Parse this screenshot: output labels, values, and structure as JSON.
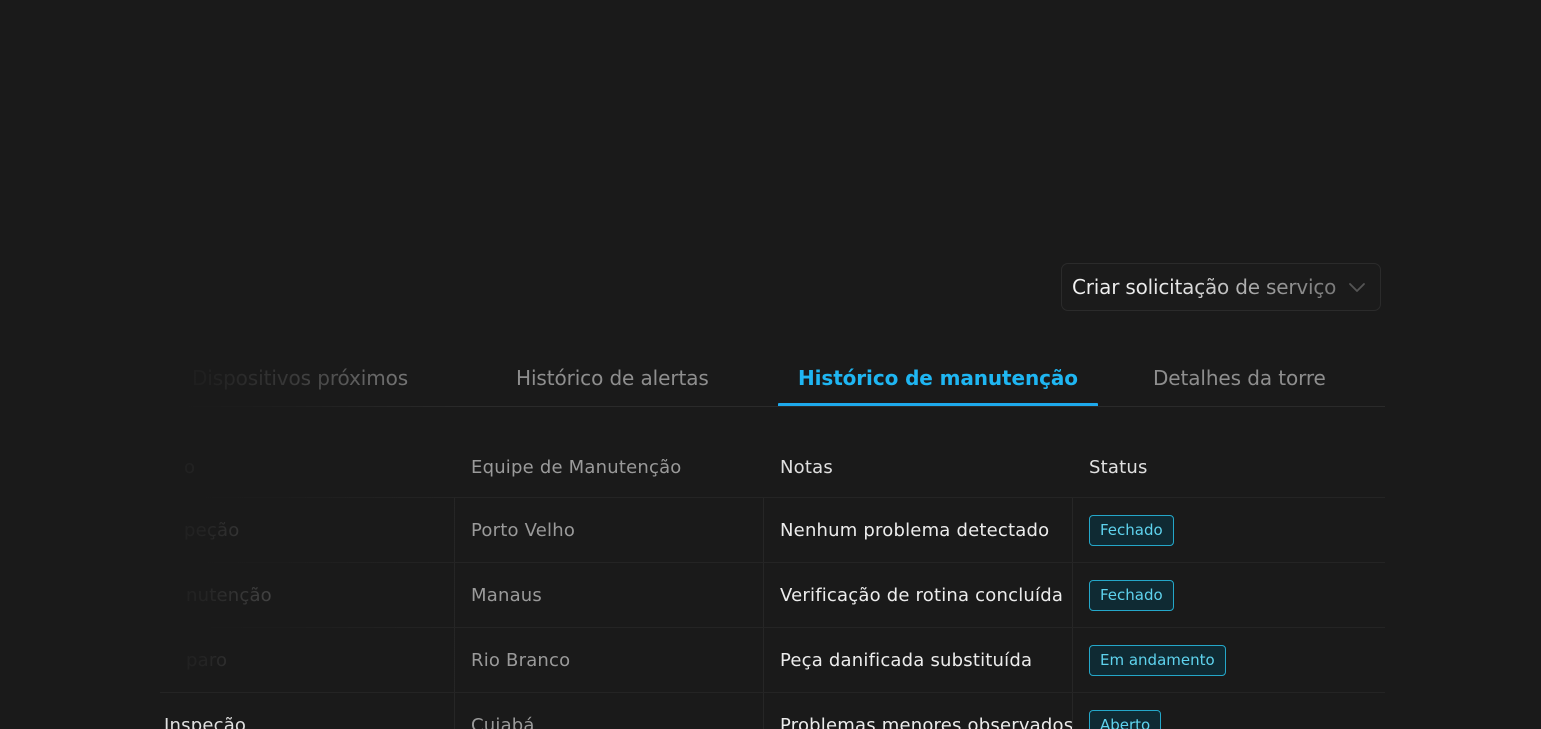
{
  "service_request": {
    "label": "Criar solicitação de serviço",
    "icon": "chevron-down-icon"
  },
  "tabs": [
    {
      "label": "Dispositivos próximos",
      "active": false
    },
    {
      "label": "Histórico de alertas",
      "active": false
    },
    {
      "label": "Histórico de manutenção",
      "active": true
    },
    {
      "label": "Detalhes da torre",
      "active": false
    }
  ],
  "table": {
    "columns": [
      "o",
      "Equipe de Manutenção",
      "Notas",
      "Status"
    ],
    "rows": [
      {
        "type": "peção",
        "team": "Porto Velho",
        "notes": "Nenhum problema detectado",
        "status": "Fechado"
      },
      {
        "type": "nutenção",
        "team": "Manaus",
        "notes": "Verificação de rotina concluída",
        "status": "Fechado"
      },
      {
        "type": "paro",
        "team": "Rio Branco",
        "notes": "Peça danificada substituída",
        "status": "Em andamento"
      },
      {
        "type": "Inspeção",
        "team": "Cuiabá",
        "notes": "Problemas menores observados",
        "status": "Aberto"
      }
    ]
  },
  "colors": {
    "background": "#1a1a1a",
    "accent": "#1fb6f2",
    "badge_border": "#24a7c9",
    "badge_text": "#5fd3ee"
  }
}
